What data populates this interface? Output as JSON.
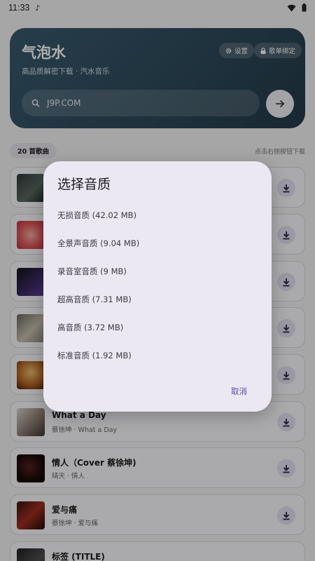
{
  "status": {
    "time": "11:33"
  },
  "hero": {
    "title": "气泡水",
    "subtitle": "高品质解密下载 · 汽水音乐",
    "settings_label": "设置",
    "bind_label": "歌单绑定",
    "search_value": "J9P.COM"
  },
  "list": {
    "count_label": "20 首歌曲",
    "hint": "点击右侧按钮下载",
    "songs": [
      {
        "name": "",
        "meta": ""
      },
      {
        "name": "",
        "meta": ""
      },
      {
        "name": "",
        "meta": ""
      },
      {
        "name": "",
        "meta": ""
      },
      {
        "name": "",
        "meta": ""
      },
      {
        "name": "What a Day",
        "meta": "蔡徐坤 · What a Day"
      },
      {
        "name": "情人（Cover 蔡徐坤)",
        "meta": "晴天 · 情人"
      },
      {
        "name": "爱与痛",
        "meta": "蔡徐坤 · 爱与痛"
      },
      {
        "name": "标签 (TITLE)",
        "meta": ""
      }
    ]
  },
  "dialog": {
    "title": "选择音质",
    "options": [
      "无损音质 (42.02 MB)",
      "全景声音质 (9.04 MB)",
      "录音室音质 (9 MB)",
      "超高音质 (7.31 MB)",
      "高音质 (3.72 MB)",
      "标准音质 (1.92 MB)"
    ],
    "cancel_label": "取消"
  },
  "icons": {
    "status_music": "music-note-icon",
    "wifi": "wifi-icon",
    "battery": "battery-icon",
    "settings": "gear-icon",
    "bind": "lock-icon",
    "search": "search-icon",
    "go": "arrow-right-icon",
    "download": "download-icon"
  },
  "colors": {
    "hero_bg": "#2e4b5c",
    "dialog_bg": "#ece8f2",
    "accent": "#5b4ba8"
  }
}
